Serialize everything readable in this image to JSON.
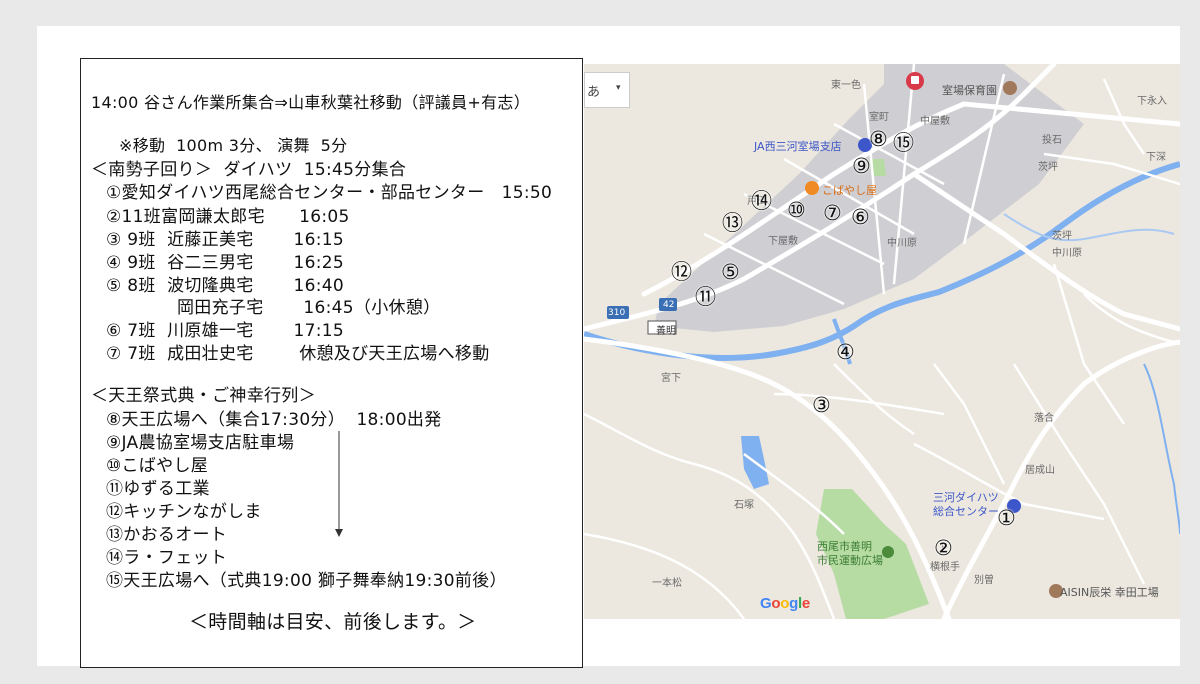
{
  "schedule": {
    "lines": [
      "14:00 谷さん作業所集合⇒山車秋葉社移動（評議員+有志）",
      "※移動  100m 3分、 演舞  5分",
      "＜南勢子回り＞  ダイハツ  15:45分集合",
      "①愛知ダイハツ西尾総合センター・部品センター   15:50",
      "②11班富岡謙太郎宅      16:05",
      "③ 9班  近藤正美宅       16:15",
      "④ 9班  谷二三男宅       16:25",
      "⑤ 8班  波切隆典宅       16:40",
      "岡田充子宅       16:45（小休憩）",
      "⑥ 7班  川原雄一宅       17:15",
      "⑦ 7班  成田壮史宅        休憩及び天王広場へ移動",
      "＜天王祭式典・ご神幸行列＞",
      "⑧天王広場へ（集合17:30分）  18:00出発",
      "⑨JA農協室場支店駐車場",
      "⑩こばやし屋",
      "⑪ゆずる工業",
      "⑫キッチンながしま",
      "⑬かおるオート",
      "⑭ラ・フェット",
      "⑮天王広場へ（式典19:00 獅子舞奉納19:30前後）",
      "＜時間軸は目安、前後します。＞"
    ]
  },
  "map": {
    "ime_label": "あ",
    "ime_caret": "▾",
    "labels": [
      "東一色",
      "室場保育園",
      "下永入",
      "室町",
      "中屋敷",
      "JA西三河室場支店",
      "戸田",
      "こばやし屋",
      "投石",
      "茨坪",
      "下深",
      "下屋敷",
      "中川原",
      "茨坪",
      "中川原",
      "310",
      "42",
      "善明",
      "宮下",
      "落合",
      "居成山",
      "石塚",
      "三河ダイハツ",
      "総合センター",
      "西尾市善明",
      "市民運動広場",
      "上",
      "横根手",
      "別曽",
      "一本松",
      "AISIN辰栄 幸田工場"
    ],
    "markers": [
      "①",
      "②",
      "③",
      "④",
      "⑤",
      "⑥",
      "⑦",
      "⑧",
      "⑨",
      "⑩",
      "⑪",
      "⑫",
      "⑬",
      "⑭",
      "⑮"
    ],
    "google_letters": [
      "G",
      "o",
      "o",
      "g",
      "l",
      "e"
    ],
    "colors": {
      "blue": "#4285F4",
      "red": "#EA4335",
      "yellow": "#FBBC05",
      "green": "#34A853",
      "road": "#ffffff",
      "urban": "#cfcfd3",
      "water": "#7fb0f0",
      "park": "#b6dca4"
    }
  }
}
